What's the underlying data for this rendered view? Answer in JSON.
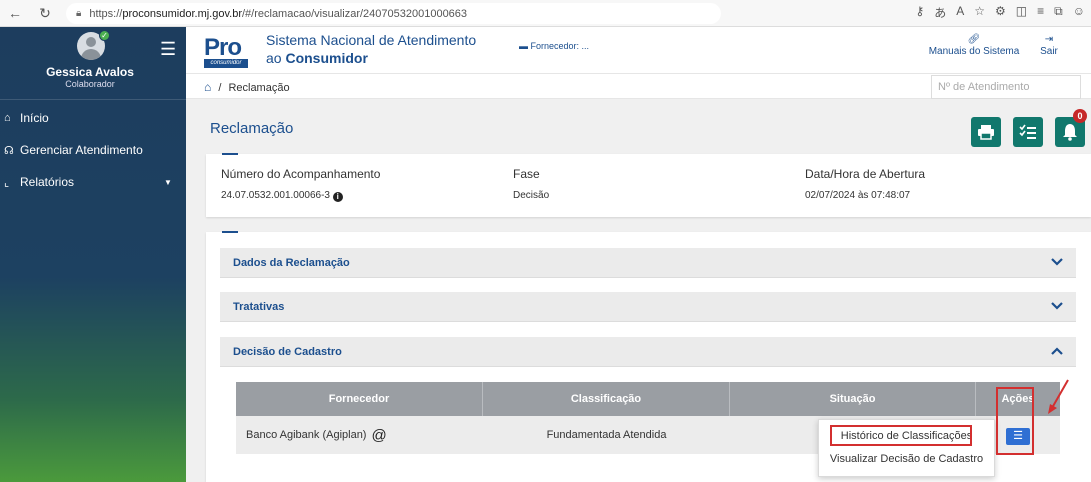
{
  "browser": {
    "url_prefix": "https://",
    "url_domain": "proconsumidor.mj.gov.br",
    "url_path": "/#/reclamacao/visualizar/24070532001000663",
    "icons": [
      "back-icon",
      "refresh-icon",
      "lock-icon",
      "key-icon",
      "translate-icon",
      "read-aloud-icon",
      "favorite-icon",
      "extensions-icon",
      "split-icon",
      "favorites-icon",
      "collections-icon",
      "profile-icon"
    ]
  },
  "sidebar": {
    "user_name": "Gessica Avalos",
    "user_role": "Colaborador",
    "items": [
      {
        "label": "Início",
        "icon": "home-icon"
      },
      {
        "label": "Gerenciar Atendimento",
        "icon": "headset-icon"
      },
      {
        "label": "Relatórios",
        "icon": "chart-icon"
      }
    ]
  },
  "header": {
    "logo_text": "Pro",
    "logo_sub": "consumidor",
    "system_line1": "Sistema Nacional de Atendimento",
    "system_line2_prefix": "ao",
    "system_line2_bold": "Consumidor",
    "fornecedor_label": "Fornecedor: ...",
    "manuais_label": "Manuais do Sistema",
    "sair_label": "Sair"
  },
  "breadcrumb": {
    "separator": "/",
    "current": "Reclamação",
    "search_placeholder": "Nº de Atendimento"
  },
  "page": {
    "title": "Reclamação",
    "notification_count": "0"
  },
  "summary": {
    "numero_label": "Número do Acompanhamento",
    "numero_value": "24.07.0532.001.00066-3",
    "fase_label": "Fase",
    "fase_value": "Decisão",
    "data_label": "Data/Hora de Abertura",
    "data_value": "02/07/2024 às 07:48:07"
  },
  "sections": [
    {
      "title": "Dados da Reclamação",
      "state": "collapsed"
    },
    {
      "title": "Tratativas",
      "state": "collapsed"
    },
    {
      "title": "Decisão de Cadastro",
      "state": "expanded"
    }
  ],
  "table": {
    "headers": [
      "Fornecedor",
      "Classificação",
      "Situação",
      "Ações"
    ],
    "rows": [
      {
        "fornecedor": "Banco Agibank (Agiplan)",
        "fornecedor_icon": "@",
        "classificacao": "Fundamentada Atendida",
        "situacao": ""
      }
    ]
  },
  "dropdown": {
    "items": [
      "Histórico de Classificações",
      "Visualizar Decisão de Cadastro"
    ]
  },
  "colors": {
    "sidebar": "#1d3d5e",
    "brand": "#1c4f8e",
    "toolbar_button": "#11786d",
    "highlight": "#d32f2f",
    "action_button": "#2f6fd3"
  }
}
